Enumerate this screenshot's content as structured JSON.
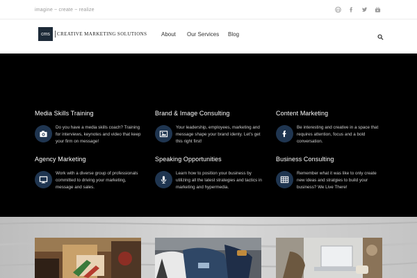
{
  "topbar": {
    "tagline": "imagine ~ create ~ realize",
    "social_icons": [
      "envelope-icon",
      "facebook-icon",
      "twitter-icon",
      "youtube-icon"
    ]
  },
  "header": {
    "logo_mark": "cms",
    "logo_text": "Creative Marketing Solutions",
    "nav": [
      {
        "label": "About"
      },
      {
        "label": "Our Services"
      },
      {
        "label": "Blog"
      }
    ],
    "search_icon": "search-icon"
  },
  "services": [
    {
      "title": "Media Skills Training",
      "icon": "camera-icon",
      "text": "Do you have a media skills coach? Training for interviews, keynotes and video that keep your firm on message!"
    },
    {
      "title": "Brand & Image Consulting",
      "icon": "image-icon",
      "text": "Your leadership, employees, marketing and message shape your brand identy. Let's get this right first!"
    },
    {
      "title": "Content Marketing",
      "icon": "facebook-icon",
      "text": "Be interesting and creative in a space that requires  attention, focus and a bold conversation."
    },
    {
      "title": "Agency Marketing",
      "icon": "monitor-icon",
      "text": "Work with a diverse group of professionals committed to driving your marketing, message and sales."
    },
    {
      "title": "Speaking Opportunities",
      "icon": "microphone-icon",
      "text": "Learn how to position your business by utilizing all the latest strategies and tactics in marketing and hypermedia."
    },
    {
      "title": "Business Consulting",
      "icon": "table-icon",
      "text": "Remember what it was like to only create new ideas and stratgies to build your business?  We Live There!"
    }
  ],
  "colors": {
    "band_bg": "#000000",
    "icon_circle": "#1f3550",
    "logo_box": "#1d2a38",
    "gray_section": "#cfcfcf"
  }
}
